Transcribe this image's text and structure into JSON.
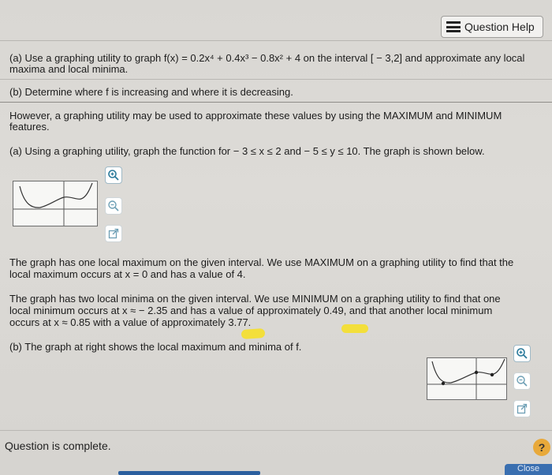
{
  "header": {
    "question_help_label": "Question Help"
  },
  "problem": {
    "part_a_prompt": "(a) Use a graphing utility to graph f(x) = 0.2x⁴ + 0.4x³ − 0.8x² + 4 on the interval [ − 3,2] and approximate any local maxima and local minima.",
    "part_a_line1": "(a) Use a graphing utility to graph f(x) = 0.2x⁴ + 0.4x³ − 0.8x² + 4 on the interval [ − 3,2] and approximate any local",
    "part_a_line2": "maxima and local minima.",
    "part_b_prompt": "(b) Determine where f is increasing and where it is decreasing."
  },
  "solution": {
    "intro_line1": "However, a graphing utility may be used to approximate these values by using the MAXIMUM and MINIMUM",
    "intro_line2": "features.",
    "part_a_step": "(a) Using a graphing utility, graph the function for  − 3 ≤ x ≤ 2 and  − 5 ≤ y ≤ 10. The graph is shown below.",
    "max_line1": "The graph has one local maximum on the given interval. We use MAXIMUM on a graphing utility to find that the",
    "max_line2": "local maximum occurs at x = 0 and has a value of 4.",
    "min_line1": "The graph has two local minima on the given interval. We use MINIMUM on a graphing utility to find that one",
    "min_line2": "local minimum occurs at x ≈  − 2.35 and has a value of approximately 0.49, and that another local minimum",
    "min_line3": "occurs at x ≈ 0.85 with a value of approximately 3.77.",
    "part_b_step": "(b) The graph at right shows the local maximum and minima of f."
  },
  "graph_tools": {
    "zoom_in_icon": "zoom-in-icon",
    "zoom_out_icon": "zoom-out-icon",
    "open_external_icon": "external-link-icon"
  },
  "footer": {
    "status": "Question is complete.",
    "help_symbol": "?",
    "close_label": "Close"
  },
  "colors": {
    "highlight": "#f5e02a",
    "help_circle": "#e8a93a",
    "close_button": "#3a6fb0"
  }
}
